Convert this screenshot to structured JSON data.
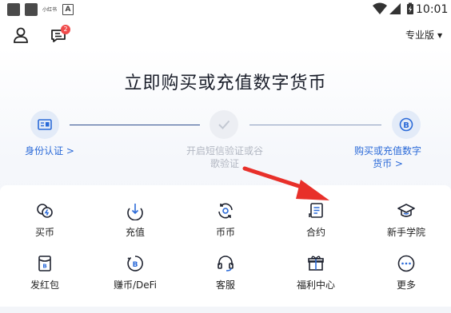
{
  "status_bar": {
    "time": "10:01",
    "tiny_text": "小红书",
    "app_icon_letter": "A"
  },
  "header": {
    "notification_count": "2",
    "mode_label": "专业版",
    "caret": "▼"
  },
  "title": "立即购买或充值数字货币",
  "steps": [
    {
      "label": "身份认证 >",
      "state": "active",
      "icon": "id-card-icon"
    },
    {
      "label_line1": "开启短信验证或谷",
      "label_line2": "歌验证",
      "state": "inactive",
      "icon": "check-icon"
    },
    {
      "label_line1": "购买或充值数字",
      "label_line2": "货币 >",
      "state": "active",
      "icon": "bitcoin-icon"
    }
  ],
  "services": [
    {
      "label": "买币",
      "icon": "buy-coin-icon"
    },
    {
      "label": "充值",
      "icon": "deposit-icon"
    },
    {
      "label": "币币",
      "icon": "convert-icon"
    },
    {
      "label": "合约",
      "icon": "contract-icon"
    },
    {
      "label": "新手学院",
      "icon": "graduation-cap-icon"
    },
    {
      "label": "发红包",
      "icon": "red-envelope-icon"
    },
    {
      "label": "赚币/DeFi",
      "icon": "earn-defi-icon"
    },
    {
      "label": "客服",
      "icon": "headset-icon"
    },
    {
      "label": "福利中心",
      "icon": "gift-icon"
    },
    {
      "label": "更多",
      "icon": "more-icon"
    }
  ],
  "colors": {
    "accent": "#2b6ad8",
    "annotation_arrow": "#e8302a",
    "badge": "#f04b4b"
  }
}
